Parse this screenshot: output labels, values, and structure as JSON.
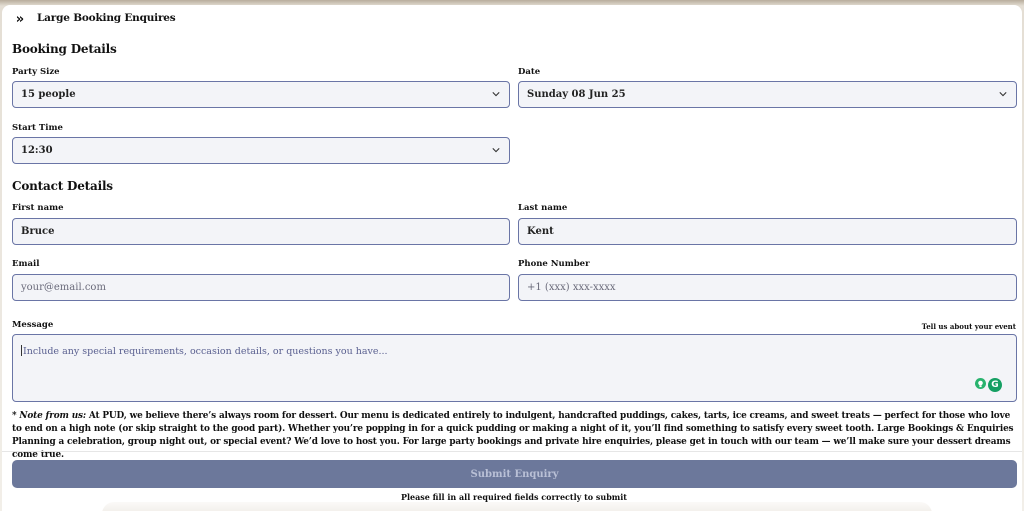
{
  "header": {
    "title": "Large Booking Enquires",
    "collapse_icon": "double-chevron-right-icon"
  },
  "booking": {
    "section_title": "Booking Details",
    "party_size": {
      "label": "Party Size",
      "value": "15 people"
    },
    "date": {
      "label": "Date",
      "value": "Sunday 08 Jun 25"
    },
    "start_time": {
      "label": "Start Time",
      "value": "12:30"
    }
  },
  "contact": {
    "section_title": "Contact Details",
    "first_name": {
      "label": "First name",
      "value": "Bruce"
    },
    "last_name": {
      "label": "Last name",
      "value": "Kent"
    },
    "email": {
      "label": "Email",
      "placeholder": "your@email.com"
    },
    "phone": {
      "label": "Phone Number",
      "placeholder": "+1 (xxx) xxx-xxxx"
    },
    "message": {
      "label": "Message",
      "helper": "Tell us about your event",
      "placeholder": "Include any special requirements, occasion details, or questions you have..."
    }
  },
  "note": {
    "prefix": "* Note from us:",
    "text": " At PUD, we believe there’s always room for dessert. Our menu is dedicated entirely to indulgent, handcrafted puddings, cakes, tarts, ice creams, and sweet treats — perfect for those who love to end on a high note (or skip straight to the good part). Whether you’re popping in for a quick pudding or making a night of it, you’ll find something to satisfy every sweet tooth. Large Bookings & Enquiries Planning a celebration, group night out, or special event? We’d love to host you. For large party bookings and private hire enquiries, please get in touch with our team — we’ll make sure your dessert dreams come true."
  },
  "submit": {
    "label": "Submit Enquiry",
    "hint": "Please fill in all required fields correctly to submit"
  },
  "colors": {
    "field_border": "#6a75a6",
    "field_bg": "#f3f4f8",
    "submit_bg": "#6c789b"
  }
}
